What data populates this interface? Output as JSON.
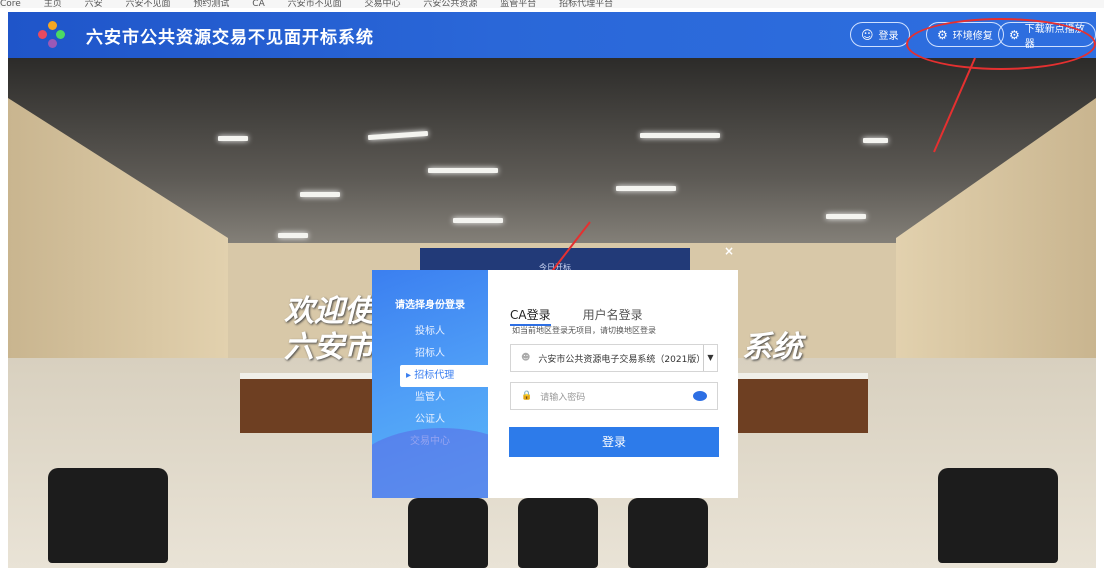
{
  "bookmarks": [
    "Core",
    "主页",
    "六安",
    "六安不见面",
    "预约测试",
    "CA",
    "六安市不见面",
    "交易中心",
    "六安公共资源",
    "监管平台",
    "招标代理平台"
  ],
  "header": {
    "title": "六安市公共资源交易不见面开标系统",
    "login_label": "登录",
    "env_repair_label": "环境修复",
    "download_player_label": "下载新点播放器"
  },
  "scene": {
    "screen_text": "今日开标",
    "welcome_line1": "欢迎使",
    "welcome_line2": "六安市",
    "welcome_line3": "系统"
  },
  "login": {
    "sidebar_title": "请选择身份登录",
    "roles": [
      "投标人",
      "招标人",
      "招标代理",
      "监管人",
      "公证人",
      "交易中心"
    ],
    "active_role_index": 2,
    "tabs": [
      "CA登录",
      "用户名登录"
    ],
    "active_tab": "CA登录",
    "hint": "如当前地区登录无项目，请切换地区登录",
    "system_select": "六安市公共资源电子交易系统（2021版）",
    "password_placeholder": "请输入密码",
    "submit_label": "登录",
    "close_label": "×"
  },
  "colors": {
    "header_blue": "#2a67d8",
    "accent": "#2d7bea",
    "annotation": "#e53030"
  }
}
